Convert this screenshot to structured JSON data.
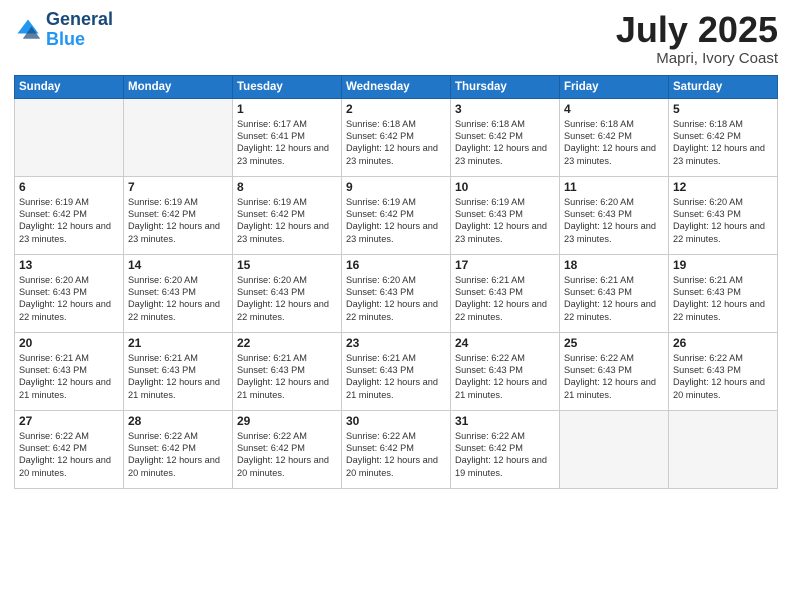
{
  "header": {
    "logo_line1": "General",
    "logo_line2": "Blue",
    "title": "July 2025",
    "location": "Mapri, Ivory Coast"
  },
  "days_of_week": [
    "Sunday",
    "Monday",
    "Tuesday",
    "Wednesday",
    "Thursday",
    "Friday",
    "Saturday"
  ],
  "weeks": [
    [
      {
        "day": "",
        "info": ""
      },
      {
        "day": "",
        "info": ""
      },
      {
        "day": "1",
        "info": "Sunrise: 6:17 AM\nSunset: 6:41 PM\nDaylight: 12 hours and 23 minutes."
      },
      {
        "day": "2",
        "info": "Sunrise: 6:18 AM\nSunset: 6:42 PM\nDaylight: 12 hours and 23 minutes."
      },
      {
        "day": "3",
        "info": "Sunrise: 6:18 AM\nSunset: 6:42 PM\nDaylight: 12 hours and 23 minutes."
      },
      {
        "day": "4",
        "info": "Sunrise: 6:18 AM\nSunset: 6:42 PM\nDaylight: 12 hours and 23 minutes."
      },
      {
        "day": "5",
        "info": "Sunrise: 6:18 AM\nSunset: 6:42 PM\nDaylight: 12 hours and 23 minutes."
      }
    ],
    [
      {
        "day": "6",
        "info": "Sunrise: 6:19 AM\nSunset: 6:42 PM\nDaylight: 12 hours and 23 minutes."
      },
      {
        "day": "7",
        "info": "Sunrise: 6:19 AM\nSunset: 6:42 PM\nDaylight: 12 hours and 23 minutes."
      },
      {
        "day": "8",
        "info": "Sunrise: 6:19 AM\nSunset: 6:42 PM\nDaylight: 12 hours and 23 minutes."
      },
      {
        "day": "9",
        "info": "Sunrise: 6:19 AM\nSunset: 6:42 PM\nDaylight: 12 hours and 23 minutes."
      },
      {
        "day": "10",
        "info": "Sunrise: 6:19 AM\nSunset: 6:43 PM\nDaylight: 12 hours and 23 minutes."
      },
      {
        "day": "11",
        "info": "Sunrise: 6:20 AM\nSunset: 6:43 PM\nDaylight: 12 hours and 23 minutes."
      },
      {
        "day": "12",
        "info": "Sunrise: 6:20 AM\nSunset: 6:43 PM\nDaylight: 12 hours and 22 minutes."
      }
    ],
    [
      {
        "day": "13",
        "info": "Sunrise: 6:20 AM\nSunset: 6:43 PM\nDaylight: 12 hours and 22 minutes."
      },
      {
        "day": "14",
        "info": "Sunrise: 6:20 AM\nSunset: 6:43 PM\nDaylight: 12 hours and 22 minutes."
      },
      {
        "day": "15",
        "info": "Sunrise: 6:20 AM\nSunset: 6:43 PM\nDaylight: 12 hours and 22 minutes."
      },
      {
        "day": "16",
        "info": "Sunrise: 6:20 AM\nSunset: 6:43 PM\nDaylight: 12 hours and 22 minutes."
      },
      {
        "day": "17",
        "info": "Sunrise: 6:21 AM\nSunset: 6:43 PM\nDaylight: 12 hours and 22 minutes."
      },
      {
        "day": "18",
        "info": "Sunrise: 6:21 AM\nSunset: 6:43 PM\nDaylight: 12 hours and 22 minutes."
      },
      {
        "day": "19",
        "info": "Sunrise: 6:21 AM\nSunset: 6:43 PM\nDaylight: 12 hours and 22 minutes."
      }
    ],
    [
      {
        "day": "20",
        "info": "Sunrise: 6:21 AM\nSunset: 6:43 PM\nDaylight: 12 hours and 21 minutes."
      },
      {
        "day": "21",
        "info": "Sunrise: 6:21 AM\nSunset: 6:43 PM\nDaylight: 12 hours and 21 minutes."
      },
      {
        "day": "22",
        "info": "Sunrise: 6:21 AM\nSunset: 6:43 PM\nDaylight: 12 hours and 21 minutes."
      },
      {
        "day": "23",
        "info": "Sunrise: 6:21 AM\nSunset: 6:43 PM\nDaylight: 12 hours and 21 minutes."
      },
      {
        "day": "24",
        "info": "Sunrise: 6:22 AM\nSunset: 6:43 PM\nDaylight: 12 hours and 21 minutes."
      },
      {
        "day": "25",
        "info": "Sunrise: 6:22 AM\nSunset: 6:43 PM\nDaylight: 12 hours and 21 minutes."
      },
      {
        "day": "26",
        "info": "Sunrise: 6:22 AM\nSunset: 6:43 PM\nDaylight: 12 hours and 20 minutes."
      }
    ],
    [
      {
        "day": "27",
        "info": "Sunrise: 6:22 AM\nSunset: 6:42 PM\nDaylight: 12 hours and 20 minutes."
      },
      {
        "day": "28",
        "info": "Sunrise: 6:22 AM\nSunset: 6:42 PM\nDaylight: 12 hours and 20 minutes."
      },
      {
        "day": "29",
        "info": "Sunrise: 6:22 AM\nSunset: 6:42 PM\nDaylight: 12 hours and 20 minutes."
      },
      {
        "day": "30",
        "info": "Sunrise: 6:22 AM\nSunset: 6:42 PM\nDaylight: 12 hours and 20 minutes."
      },
      {
        "day": "31",
        "info": "Sunrise: 6:22 AM\nSunset: 6:42 PM\nDaylight: 12 hours and 19 minutes."
      },
      {
        "day": "",
        "info": ""
      },
      {
        "day": "",
        "info": ""
      }
    ]
  ]
}
